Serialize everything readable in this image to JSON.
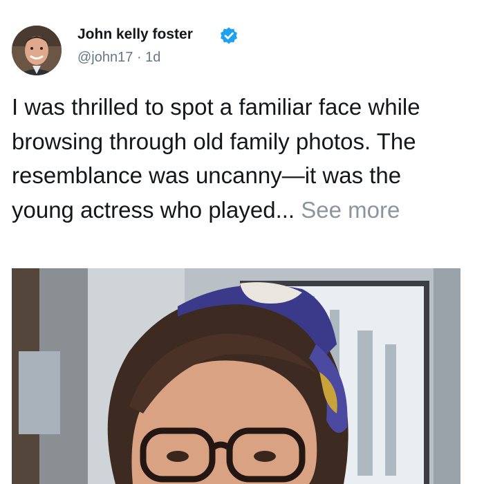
{
  "post": {
    "author_name": "John kelly foster",
    "handle": "@john17",
    "separator": "·",
    "time_ago": "1d",
    "text": "I was thrilled to spot a familiar face while browsing through old family photos. The resemblance was uncanny—it was the young actress who played...",
    "see_more": "See more",
    "colors": {
      "verified": "#1da1f2",
      "text": "#14171a",
      "muted": "#657786"
    },
    "icons": {
      "verified": "verified-badge-icon"
    }
  }
}
